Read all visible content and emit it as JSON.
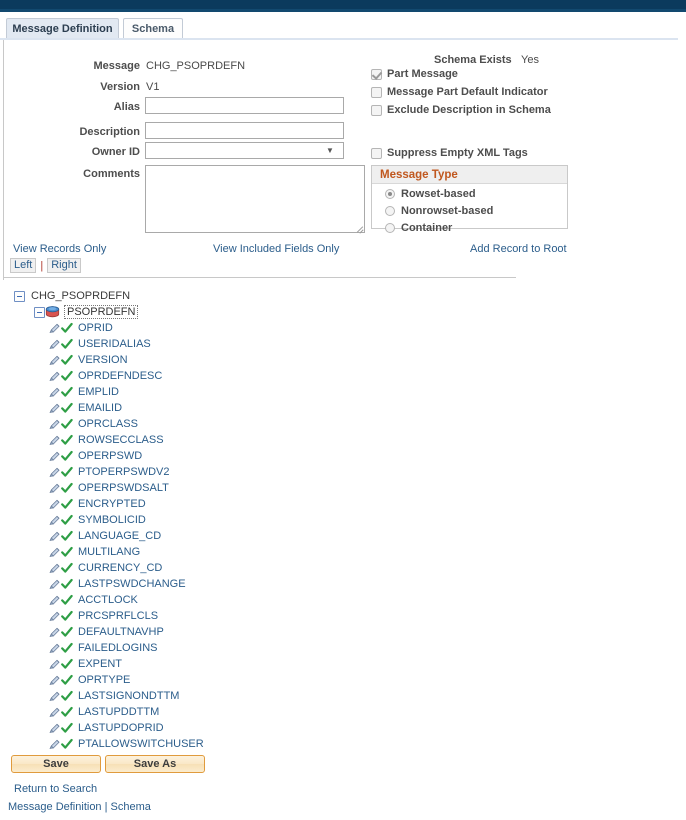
{
  "window": {
    "topbar_color": "#0b3a5d",
    "accent_color": "#c0571e",
    "link_color": "#2b5d8b"
  },
  "tabs": [
    {
      "label": "Message Definition",
      "active": true
    },
    {
      "label": "Schema",
      "active": false
    }
  ],
  "form": {
    "message_label": "Message",
    "message_value": "CHG_PSOPRDEFN",
    "version_label": "Version",
    "version_value": "V1",
    "alias_label": "Alias",
    "alias_value": "",
    "description_label": "Description",
    "description_value": "",
    "owner_id_label": "Owner ID",
    "owner_id_value": "",
    "comments_label": "Comments",
    "comments_value": ""
  },
  "schema_status": {
    "label": "Schema Exists",
    "value": "Yes"
  },
  "checkboxes": [
    {
      "label": "Part Message",
      "checked": true,
      "disabled": true
    },
    {
      "label": "Message Part Default Indicator",
      "checked": false,
      "disabled": false
    },
    {
      "label": "Exclude Description in Schema",
      "checked": false,
      "disabled": false
    }
  ],
  "suppress_checkbox": {
    "label": "Suppress Empty XML Tags",
    "checked": false
  },
  "message_type": {
    "title": "Message Type",
    "options": [
      {
        "label": "Rowset-based",
        "selected": true
      },
      {
        "label": "Nonrowset-based",
        "selected": false
      },
      {
        "label": "Container",
        "selected": false
      }
    ]
  },
  "action_links": {
    "view_records_only": "View Records Only",
    "view_included_fields_only": "View Included Fields Only",
    "add_record_to_root": "Add Record to Root"
  },
  "align": {
    "left": "Left",
    "separator": "|",
    "right": "Right"
  },
  "tree": {
    "root": "CHG_PSOPRDEFN",
    "record": "PSOPRDEFN",
    "fields": [
      "OPRID",
      "USERIDALIAS",
      "VERSION",
      "OPRDEFNDESC",
      "EMPLID",
      "EMAILID",
      "OPRCLASS",
      "ROWSECCLASS",
      "OPERPSWD",
      "PTOPERPSWDV2",
      "OPERPSWDSALT",
      "ENCRYPTED",
      "SYMBOLICID",
      "LANGUAGE_CD",
      "MULTILANG",
      "CURRENCY_CD",
      "LASTPSWDCHANGE",
      "ACCTLOCK",
      "PRCSPRFLCLS",
      "DEFAULTNAVHP",
      "FAILEDLOGINS",
      "EXPENT",
      "OPRTYPE",
      "LASTSIGNONDTTM",
      "LASTUPDDTTM",
      "LASTUPDOPRID",
      "PTALLOWSWITCHUSER"
    ]
  },
  "buttons": {
    "save": "Save",
    "save_as": "Save As"
  },
  "footer": {
    "return_to_search": "Return to Search",
    "message_definition": "Message Definition",
    "separator": "|",
    "schema": "Schema"
  }
}
